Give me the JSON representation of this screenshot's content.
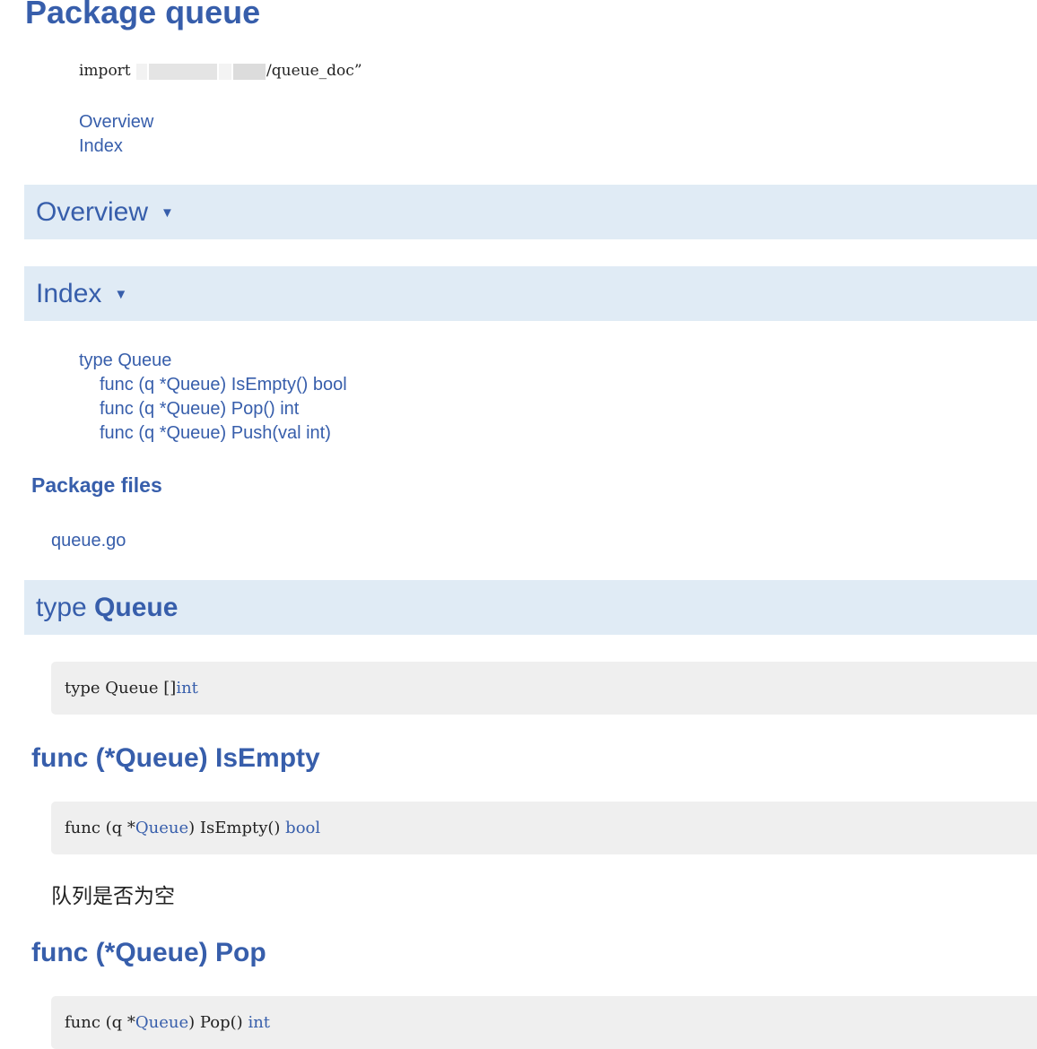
{
  "page": {
    "title": "Package queue"
  },
  "import_line": {
    "keyword": "import",
    "suffix": "/queue_doc”"
  },
  "toc": [
    {
      "label": "Overview"
    },
    {
      "label": "Index"
    }
  ],
  "sections": {
    "overview": {
      "label": "Overview",
      "arrow": "▼"
    },
    "index": {
      "label": "Index",
      "arrow": "▼"
    },
    "type_queue": {
      "prefix": "type ",
      "name": "Queue"
    }
  },
  "index_items": [
    {
      "label": "type Queue"
    },
    {
      "label": "func (q *Queue) IsEmpty() bool"
    },
    {
      "label": "func (q *Queue) Pop() int"
    },
    {
      "label": "func (q *Queue) Push(val int)"
    }
  ],
  "package_files": {
    "heading": "Package files",
    "files": [
      "queue.go"
    ]
  },
  "type_decl": {
    "part1": "type Queue []",
    "type_ref": "int"
  },
  "methods": [
    {
      "heading": "func (*Queue) IsEmpty",
      "sig_prefix": "func (q *",
      "recv_ref": "Queue",
      "sig_mid": ") IsEmpty() ",
      "ret_ref": "bool",
      "description": "队列是否为空"
    },
    {
      "heading": "func (*Queue) Pop",
      "sig_prefix": "func (q *",
      "recv_ref": "Queue",
      "sig_mid": ") Pop() ",
      "ret_ref": "int"
    }
  ],
  "colors": {
    "link": "#375eab",
    "section_bg": "#e0ebf5",
    "code_bg": "#efefef",
    "text": "#222222"
  }
}
